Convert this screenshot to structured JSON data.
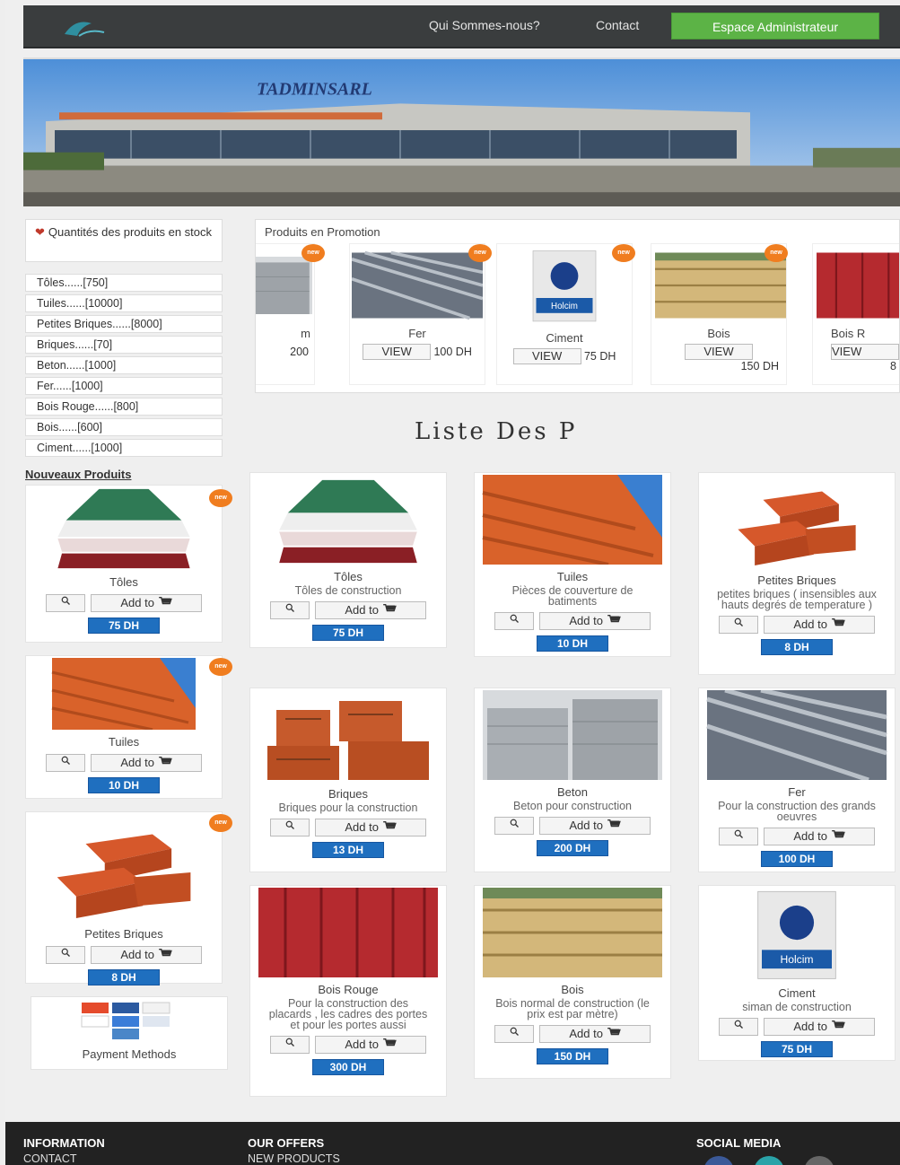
{
  "navbar": {
    "links": [
      "Qui Sommes-nous?",
      "Contact"
    ],
    "admin_button": "Espace Administrateur"
  },
  "banner": {
    "sign_text": "TADMINSARL"
  },
  "stock": {
    "title": "Quantités des produits en stock",
    "items": [
      "Tôles......[750]",
      "Tuiles......[10000]",
      "Petites Briques......[8000]",
      "Briques......[70]",
      "Beton......[1000]",
      "Fer......[1000]",
      "Bois Rouge......[800]",
      "Bois......[600]",
      "Ciment......[1000]"
    ]
  },
  "new_products": {
    "title": "Nouveaux Produits",
    "badge": "new",
    "items": [
      {
        "name": "Tôles",
        "price": "75 DH"
      },
      {
        "name": "Tuiles",
        "price": "10 DH"
      },
      {
        "name": "Petites Briques",
        "price": "8 DH"
      }
    ]
  },
  "add_label": "Add to",
  "promo": {
    "title": "Produits en Promotion",
    "view_label": "VIEW",
    "items": [
      {
        "name": "m",
        "price": "200"
      },
      {
        "name": "Fer",
        "price": "100 DH"
      },
      {
        "name": "Ciment",
        "price": "75 DH"
      },
      {
        "name": "Bois",
        "price": "150 DH"
      },
      {
        "name": "Bois R",
        "price": "8"
      }
    ]
  },
  "list_title": "Liste Des P",
  "products": [
    {
      "name": "Tôles",
      "desc": "Tôles de construction",
      "price": "75 DH"
    },
    {
      "name": "Tuiles",
      "desc": "Pièces de couverture de batiments",
      "price": "10 DH"
    },
    {
      "name": "Petites Briques",
      "desc": "petites briques ( insensibles aux hauts degrés de temperature )",
      "price": "8 DH"
    },
    {
      "name": "Briques",
      "desc": "Briques pour la construction",
      "price": "13 DH"
    },
    {
      "name": "Beton",
      "desc": "Beton pour construction",
      "price": "200 DH"
    },
    {
      "name": "Fer",
      "desc": "Pour la construction des grands oeuvres",
      "price": "100 DH"
    },
    {
      "name": "Bois Rouge",
      "desc": "Pour la construction des placards , les cadres des portes et pour les portes aussi",
      "price": "300 DH"
    },
    {
      "name": "Bois",
      "desc": "Bois normal de construction (le prix est par mètre)",
      "price": "150 DH"
    },
    {
      "name": "Ciment",
      "desc": "siman de construction",
      "price": "75 DH"
    }
  ],
  "payment": {
    "label": "Payment Methods"
  },
  "footer": {
    "information": {
      "title": "INFORMATION",
      "link": "CONTACT"
    },
    "offers": {
      "title": "OUR OFFERS",
      "link": "NEW PRODUCTS"
    },
    "social": {
      "title": "SOCIAL MEDIA"
    }
  },
  "colors": {
    "accent_green": "#5cb346",
    "price_blue": "#1f6fbf",
    "badge_orange": "#f07d1f",
    "navbar": "#3a3d3e"
  }
}
